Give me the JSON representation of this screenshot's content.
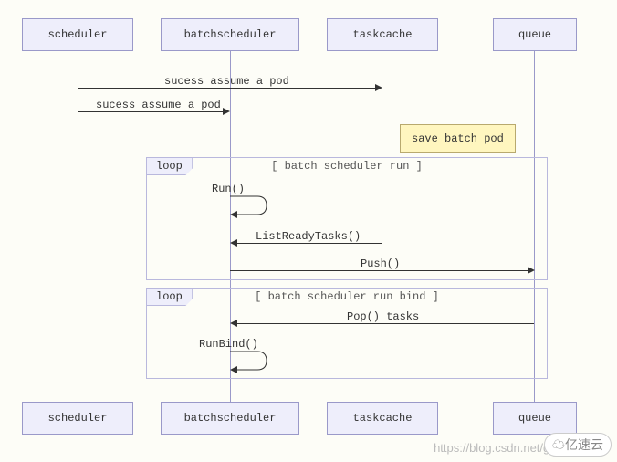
{
  "participants": {
    "p1": "scheduler",
    "p2": "batchscheduler",
    "p3": "taskcache",
    "p4": "queue"
  },
  "messages": {
    "m1": "sucess assume a pod",
    "m2": "sucess assume a pod",
    "note1": "save batch pod",
    "loop1_tag": "loop",
    "loop1_title": "[ batch scheduler run ]",
    "run": "Run()",
    "listready": "ListReadyTasks()",
    "push": "Push()",
    "loop2_tag": "loop",
    "loop2_title": "[ batch scheduler run bind ]",
    "pop": "Pop() tasks",
    "runbind": "RunBind()"
  },
  "watermark": "https://blog.csdn.net/gith",
  "logo": "亿速云"
}
